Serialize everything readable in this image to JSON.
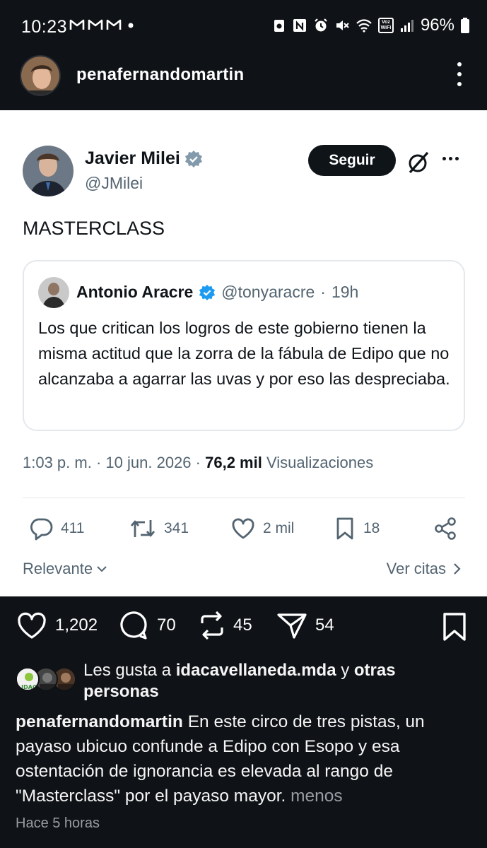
{
  "status_bar": {
    "time": "10:23",
    "battery": "96%",
    "left_icons": [
      "gmail-icon",
      "gmail-icon",
      "gmail-icon",
      "dot-icon"
    ],
    "right_icons": [
      "data-saver-icon",
      "nfc-icon",
      "alarm-icon",
      "mute-icon",
      "wifi-icon",
      "vowifi-icon",
      "signal-icon",
      "battery-icon"
    ],
    "vowifi_label": "Voz WiFi"
  },
  "header": {
    "username": "penafernandomartin"
  },
  "tweet": {
    "author_name": "Javier Milei",
    "author_handle": "@JMilei",
    "follow_label": "Seguir",
    "text": "MASTERCLASS",
    "quote": {
      "author_name": "Antonio Aracre",
      "author_handle": "@tonyaracre",
      "time": "19h",
      "text": "Los que critican los logros de este gobierno tienen la misma actitud que la zorra de la fábula de Edipo que no alcanzaba a agarrar las uvas y por eso las despreciaba."
    },
    "meta": {
      "time": "1:03 p. m.",
      "date": "10 jun. 2026",
      "views_count": "76,2 mil",
      "views_label": "Visualizaciones"
    },
    "actions": {
      "replies": "411",
      "retweets": "341",
      "likes": "2 mil",
      "bookmarks": "18"
    },
    "footer": {
      "sort_label": "Relevante",
      "quotes_label": "Ver citas"
    }
  },
  "post": {
    "likes": "1,202",
    "comments": "70",
    "reposts": "45",
    "shares": "54",
    "liked_by_prefix": "Les gusta a",
    "liked_by_user": "idacavellaneda.mda",
    "liked_by_suffix_connector": "y",
    "liked_by_others": "otras personas",
    "liked_avatar_badge": "IDAC",
    "caption_user": "penafernandomartin",
    "caption_text": "En este circo de tres pistas, un payaso ubicuo confunde a Edipo con Esopo y esa ostentación de ignorancia es elevada al rango de \"Masterclass\" por el payaso mayor.",
    "caption_more": "menos",
    "timestamp": "Hace 5 horas"
  },
  "colors": {
    "background": "#0f1216",
    "tweet_bg": "#ffffff",
    "verified_blue": "#1d9bf0",
    "verified_gray": "#829aab",
    "muted_text": "#536471"
  }
}
